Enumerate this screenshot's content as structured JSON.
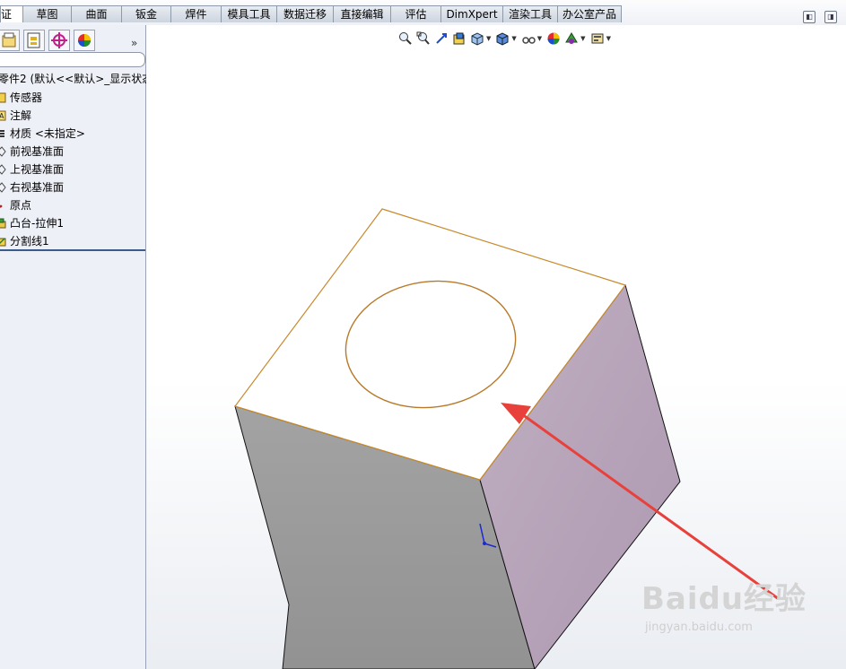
{
  "tabs": [
    {
      "label": "证",
      "active": true
    },
    {
      "label": "草图",
      "active": false
    },
    {
      "label": "曲面",
      "active": false
    },
    {
      "label": "钣金",
      "active": false
    },
    {
      "label": "焊件",
      "active": false
    },
    {
      "label": "模具工具",
      "active": false
    },
    {
      "label": "数据迁移",
      "active": false
    },
    {
      "label": "直接编辑",
      "active": false
    },
    {
      "label": "评估",
      "active": false
    },
    {
      "label": "DimXpert",
      "active": false
    },
    {
      "label": "渲染工具",
      "active": false
    },
    {
      "label": "办公室产品",
      "active": false
    }
  ],
  "left_pane": {
    "expand_glyph": "»",
    "tab_icons": [
      "feature-manager-icon",
      "property-manager-icon",
      "configuration-manager-icon",
      "display-manager-icon"
    ]
  },
  "tree": {
    "root_label": "零件2 (默认<<默认>_显示状态",
    "items": [
      {
        "label": "传感器",
        "icon": "sensor-icon"
      },
      {
        "label": "注解",
        "icon": "annotation-icon"
      },
      {
        "label": "材质 <未指定>",
        "icon": "material-icon"
      },
      {
        "label": "前视基准面",
        "icon": "plane-icon"
      },
      {
        "label": "上视基准面",
        "icon": "plane-icon"
      },
      {
        "label": "右视基准面",
        "icon": "plane-icon"
      },
      {
        "label": "原点",
        "icon": "origin-icon"
      },
      {
        "label": "凸台-拉伸1",
        "icon": "boss-extrude-icon"
      },
      {
        "label": "分割线1",
        "icon": "split-line-icon"
      }
    ]
  },
  "heads_up_toolbar": [
    "zoom-to-fit-icon",
    "zoom-to-area-icon",
    "previous-view-icon",
    "section-view-icon",
    "view-orientation-icon",
    "display-style-icon",
    "hide-show-items-icon",
    "edit-appearance-icon",
    "apply-scene-icon",
    "view-settings-icon"
  ],
  "model": {
    "top_face_color": "#ffffff",
    "left_face_color": "#9a9a9a",
    "right_face_color": "#b6a3b8",
    "edge_highlight_color": "#c88a2c",
    "arrow_color": "#e8413c"
  },
  "watermark": {
    "logo_text": "Baidu经验",
    "url": "jingyan.baidu.com"
  }
}
